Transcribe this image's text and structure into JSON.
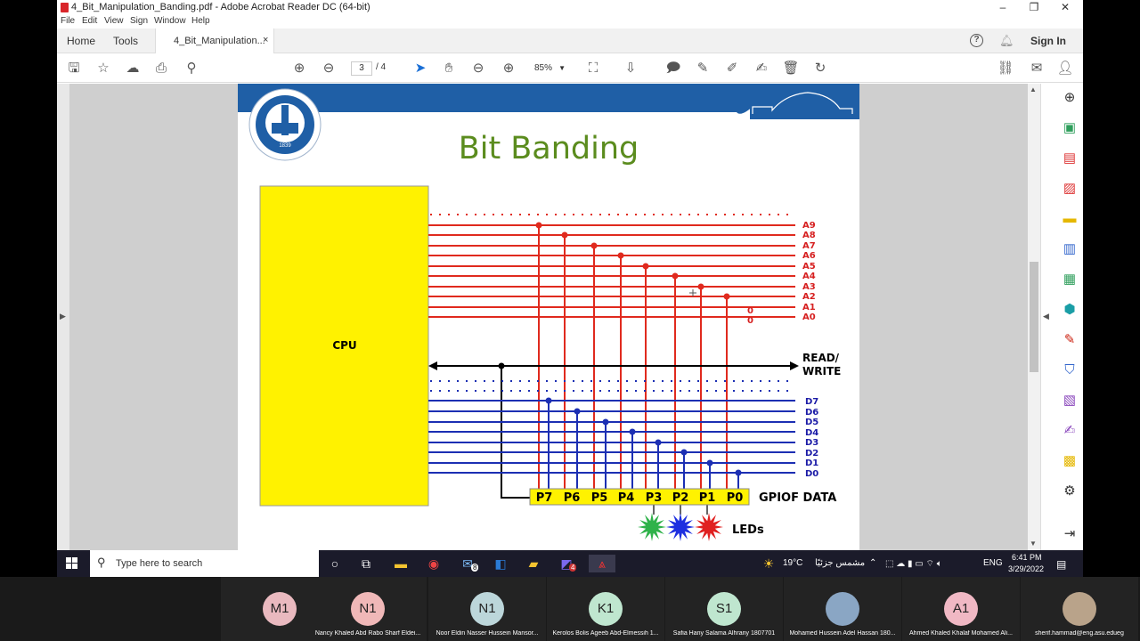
{
  "window": {
    "title": "4_Bit_Manipulation_Banding.pdf - Adobe Acrobat Reader DC (64-bit)",
    "controls": [
      "–",
      "❐",
      "✕"
    ]
  },
  "menu": [
    "File",
    "Edit",
    "View",
    "Sign",
    "Window",
    "Help"
  ],
  "tabs": {
    "home": "Home",
    "tools": "Tools",
    "doc": "4_Bit_Manipulation...",
    "close": "×",
    "help": "?",
    "sign_in": "Sign In"
  },
  "toolbar": {
    "page_current": "3",
    "page_total": "/  4",
    "zoom": "85%"
  },
  "slide": {
    "title": "Bit Banding",
    "logo_year": "1839",
    "cpu_label": "CPU",
    "address_labels": [
      "A9",
      "A8",
      "A7",
      "A6",
      "A5",
      "A4",
      "A3",
      "A2",
      "A1",
      "A0"
    ],
    "zero_labels": [
      "0",
      "0"
    ],
    "rw_label_1": "READ/",
    "rw_label_2": "WRITE",
    "data_labels": [
      "D7",
      "D6",
      "D5",
      "D4",
      "D3",
      "D2",
      "D1",
      "D0"
    ],
    "port_labels": [
      "P7",
      "P6",
      "P5",
      "P4",
      "P3",
      "P2",
      "P1",
      "P0"
    ],
    "port_name": "GPIOF DATA",
    "leds_label": "LEDs",
    "led_colors": [
      "#2fb24a",
      "#1d2fe0",
      "#e02020"
    ]
  },
  "taskbar": {
    "search_placeholder": "Type here to search",
    "weather": "19°C",
    "weather_desc": "مشمس جزئيًا",
    "lang": "ENG",
    "time": "6:41 PM",
    "date": "3/29/2022",
    "mail_badge": "8",
    "teams_badge": "4"
  },
  "participants": [
    {
      "initials": "M1",
      "name": "",
      "color": "#e9b9bf"
    },
    {
      "initials": "N1",
      "name": "Nancy Khaled Abd Rabo Sharf Eldei...",
      "color": "#f0b8b8"
    },
    {
      "initials": "N1",
      "name": "Noor Eldin Nasser Hussein Mansor...",
      "color": "#bcd6da"
    },
    {
      "initials": "K1",
      "name": "Kerolos Bolis Ageeb Abd-Elmessih 1...",
      "color": "#bfe6cf"
    },
    {
      "initials": "S1",
      "name": "Safia Hany Salama Alhrany 1807701",
      "color": "#bfe6cf"
    },
    {
      "initials": "",
      "name": "Mohamed Hussein Adel Hassan 180...",
      "color": "#8aa6c4"
    },
    {
      "initials": "A1",
      "name": "Ahmed Khaled Khalaf Mohamed Ali...",
      "color": "#f0b8c4"
    },
    {
      "initials": "",
      "name": "sherif.hammad@eng.asu.edueg",
      "color": "#b9a38a"
    }
  ]
}
